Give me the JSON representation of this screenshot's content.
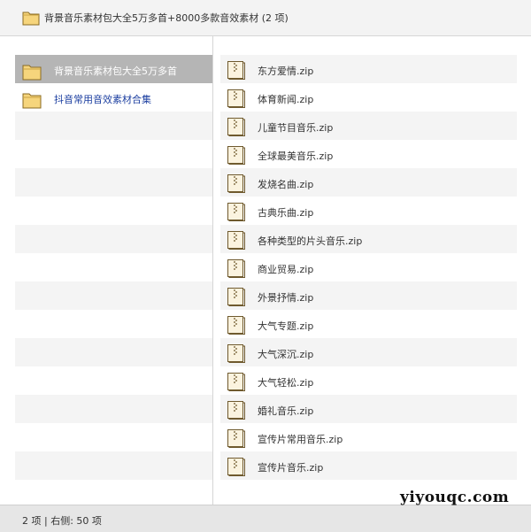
{
  "window": {
    "title": "背景音乐素材包大全5万多首+8000多款音效素材 (2 项)"
  },
  "colors": {
    "folder_fill": "#f6d57c",
    "folder_stroke": "#8a6a22",
    "selected_row": "#b5b5b5",
    "link_text": "#1c3fa0",
    "zip_fill": "#fbf3df",
    "zip_stroke": "#6f5a2e"
  },
  "left_pane": {
    "items": [
      {
        "label": "背景音乐素材包大全5万多首",
        "icon": "folder-icon",
        "selected": true
      },
      {
        "label": "抖音常用音效素材合集",
        "icon": "folder-icon",
        "selected": false
      }
    ]
  },
  "right_pane": {
    "items": [
      {
        "label": "东方爱情.zip",
        "icon": "zip-file-icon"
      },
      {
        "label": "体育新闻.zip",
        "icon": "zip-file-icon"
      },
      {
        "label": "儿童节目音乐.zip",
        "icon": "zip-file-icon"
      },
      {
        "label": "全球最美音乐.zip",
        "icon": "zip-file-icon"
      },
      {
        "label": "发烧名曲.zip",
        "icon": "zip-file-icon"
      },
      {
        "label": "古典乐曲.zip",
        "icon": "zip-file-icon"
      },
      {
        "label": "各种类型的片头音乐.zip",
        "icon": "zip-file-icon"
      },
      {
        "label": "商业贸易.zip",
        "icon": "zip-file-icon"
      },
      {
        "label": "外景抒情.zip",
        "icon": "zip-file-icon"
      },
      {
        "label": "大气专题.zip",
        "icon": "zip-file-icon"
      },
      {
        "label": "大气深沉.zip",
        "icon": "zip-file-icon"
      },
      {
        "label": "大气轻松.zip",
        "icon": "zip-file-icon"
      },
      {
        "label": "婚礼音乐.zip",
        "icon": "zip-file-icon"
      },
      {
        "label": "宣传片常用音乐.zip",
        "icon": "zip-file-icon"
      },
      {
        "label": "宣传片音乐.zip",
        "icon": "zip-file-icon"
      }
    ]
  },
  "status_bar": {
    "text": "2 项 | 右侧: 50 项"
  },
  "watermark": {
    "text": "yiyouqc.com"
  }
}
